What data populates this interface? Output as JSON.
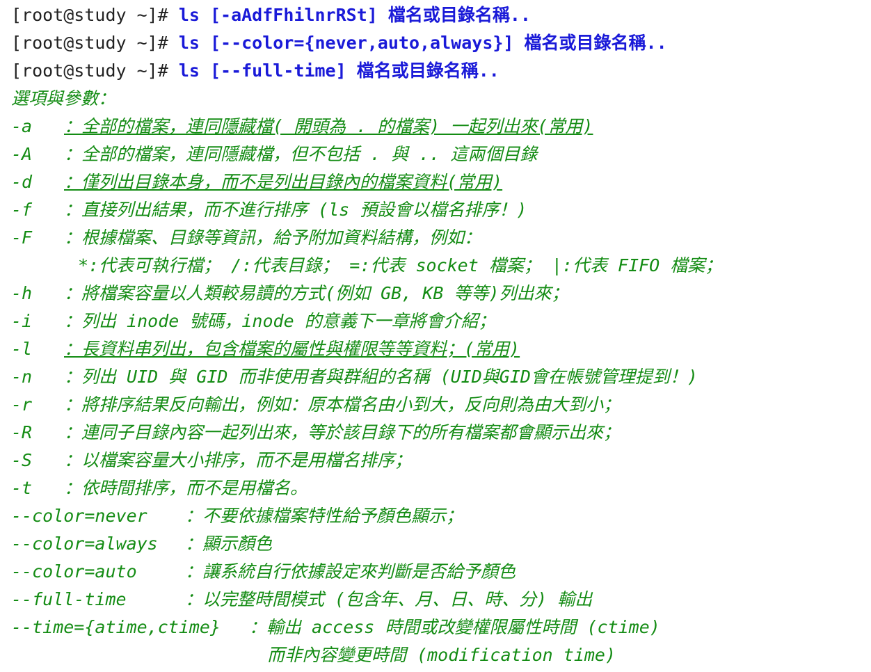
{
  "prompt": "[root@study ~]# ",
  "commands": [
    "ls [-aAdfFhilnrRSt] 檔名或目錄名稱..",
    "ls [--color={never,auto,always}] 檔名或目錄名稱..",
    "ls [--full-time] 檔名或目錄名稱.."
  ],
  "options_heading": "選項與參數：",
  "options": [
    {
      "flag": "-a",
      "desc": "：全部的檔案，連同隱藏檔( 開頭為 . 的檔案) 一起列出來(常用)",
      "underline": true
    },
    {
      "flag": "-A",
      "desc": "：全部的檔案，連同隱藏檔，但不包括 . 與 .. 這兩個目錄",
      "underline": false
    },
    {
      "flag": "-d",
      "desc": "：僅列出目錄本身，而不是列出目錄內的檔案資料(常用)",
      "underline": true
    },
    {
      "flag": "-f",
      "desc": "：直接列出結果，而不進行排序 (ls 預設會以檔名排序！)",
      "underline": false
    },
    {
      "flag": "-F",
      "desc": "：根據檔案、目錄等資訊，給予附加資料結構，例如：",
      "underline": false
    },
    {
      "flag": "",
      "desc": "*:代表可執行檔； /:代表目錄； =:代表 socket 檔案； |:代表 FIFO 檔案；",
      "underline": false
    },
    {
      "flag": "-h",
      "desc": "：將檔案容量以人類較易讀的方式(例如 GB, KB 等等)列出來；",
      "underline": false
    },
    {
      "flag": "-i",
      "desc": "：列出 inode 號碼，inode 的意義下一章將會介紹；",
      "underline": false
    },
    {
      "flag": "-l",
      "desc": "：長資料串列出，包含檔案的屬性與權限等等資料；(常用)",
      "underline": true
    },
    {
      "flag": "-n",
      "desc": "：列出 UID 與 GID 而非使用者與群組的名稱 (UID與GID會在帳號管理提到！)",
      "underline": false
    },
    {
      "flag": "-r",
      "desc": "：將排序結果反向輸出，例如：原本檔名由小到大，反向則為由大到小；",
      "underline": false
    },
    {
      "flag": "-R",
      "desc": "：連同子目錄內容一起列出來，等於該目錄下的所有檔案都會顯示出來；",
      "underline": false
    },
    {
      "flag": "-S",
      "desc": "：以檔案容量大小排序，而不是用檔名排序；",
      "underline": false
    },
    {
      "flag": "-t",
      "desc": "：依時間排序，而不是用檔名。",
      "underline": false
    }
  ],
  "long_options": [
    {
      "flag": "--color=never",
      "desc": "：不要依據檔案特性給予顏色顯示；"
    },
    {
      "flag": "--color=always",
      "desc": "：顯示顏色"
    },
    {
      "flag": "--color=auto",
      "desc": "：讓系統自行依據設定來判斷是否給予顏色"
    },
    {
      "flag": "--full-time",
      "desc": "：以完整時間模式 (包含年、月、日、時、分) 輸出"
    },
    {
      "flag": "--time={atime,ctime}",
      "desc": "：輸出 access 時間或改變權限屬性時間 (ctime)"
    },
    {
      "flag": "",
      "desc": "而非內容變更時間 (modification time)"
    }
  ],
  "colors": {
    "prompt": "#222222",
    "command": "#1a1ad8",
    "options": "#148c14"
  }
}
